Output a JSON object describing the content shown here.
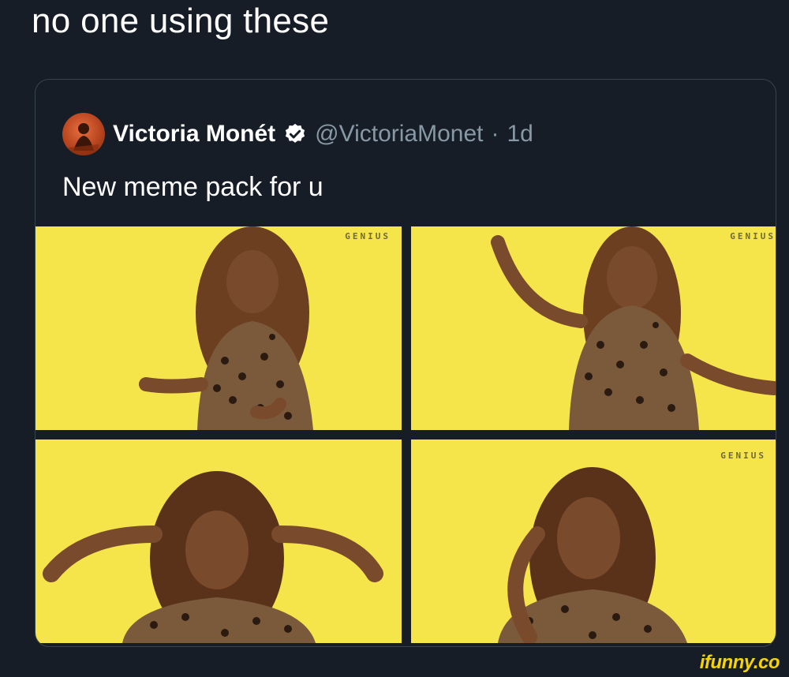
{
  "post": {
    "caption": "no one using these"
  },
  "quoted_tweet": {
    "display_name": "Victoria Monét",
    "handle": "@VictoriaMonet",
    "separator": "·",
    "time": "1d",
    "text": "New meme pack for u",
    "verified": true
  },
  "media": {
    "watermarks": [
      "GENIUS",
      "GENIUS",
      "GENIUS"
    ]
  },
  "site_watermark": "ifunny.co",
  "colors": {
    "background": "#161d27",
    "card_border": "#38444d",
    "secondary_text": "#8899a6",
    "verified_badge": "#ffffff",
    "tile_yellow": "#f5e44a",
    "watermark": "#f5d400"
  },
  "icons": {
    "verified": "verified-badge-icon",
    "avatar": "profile-avatar"
  }
}
